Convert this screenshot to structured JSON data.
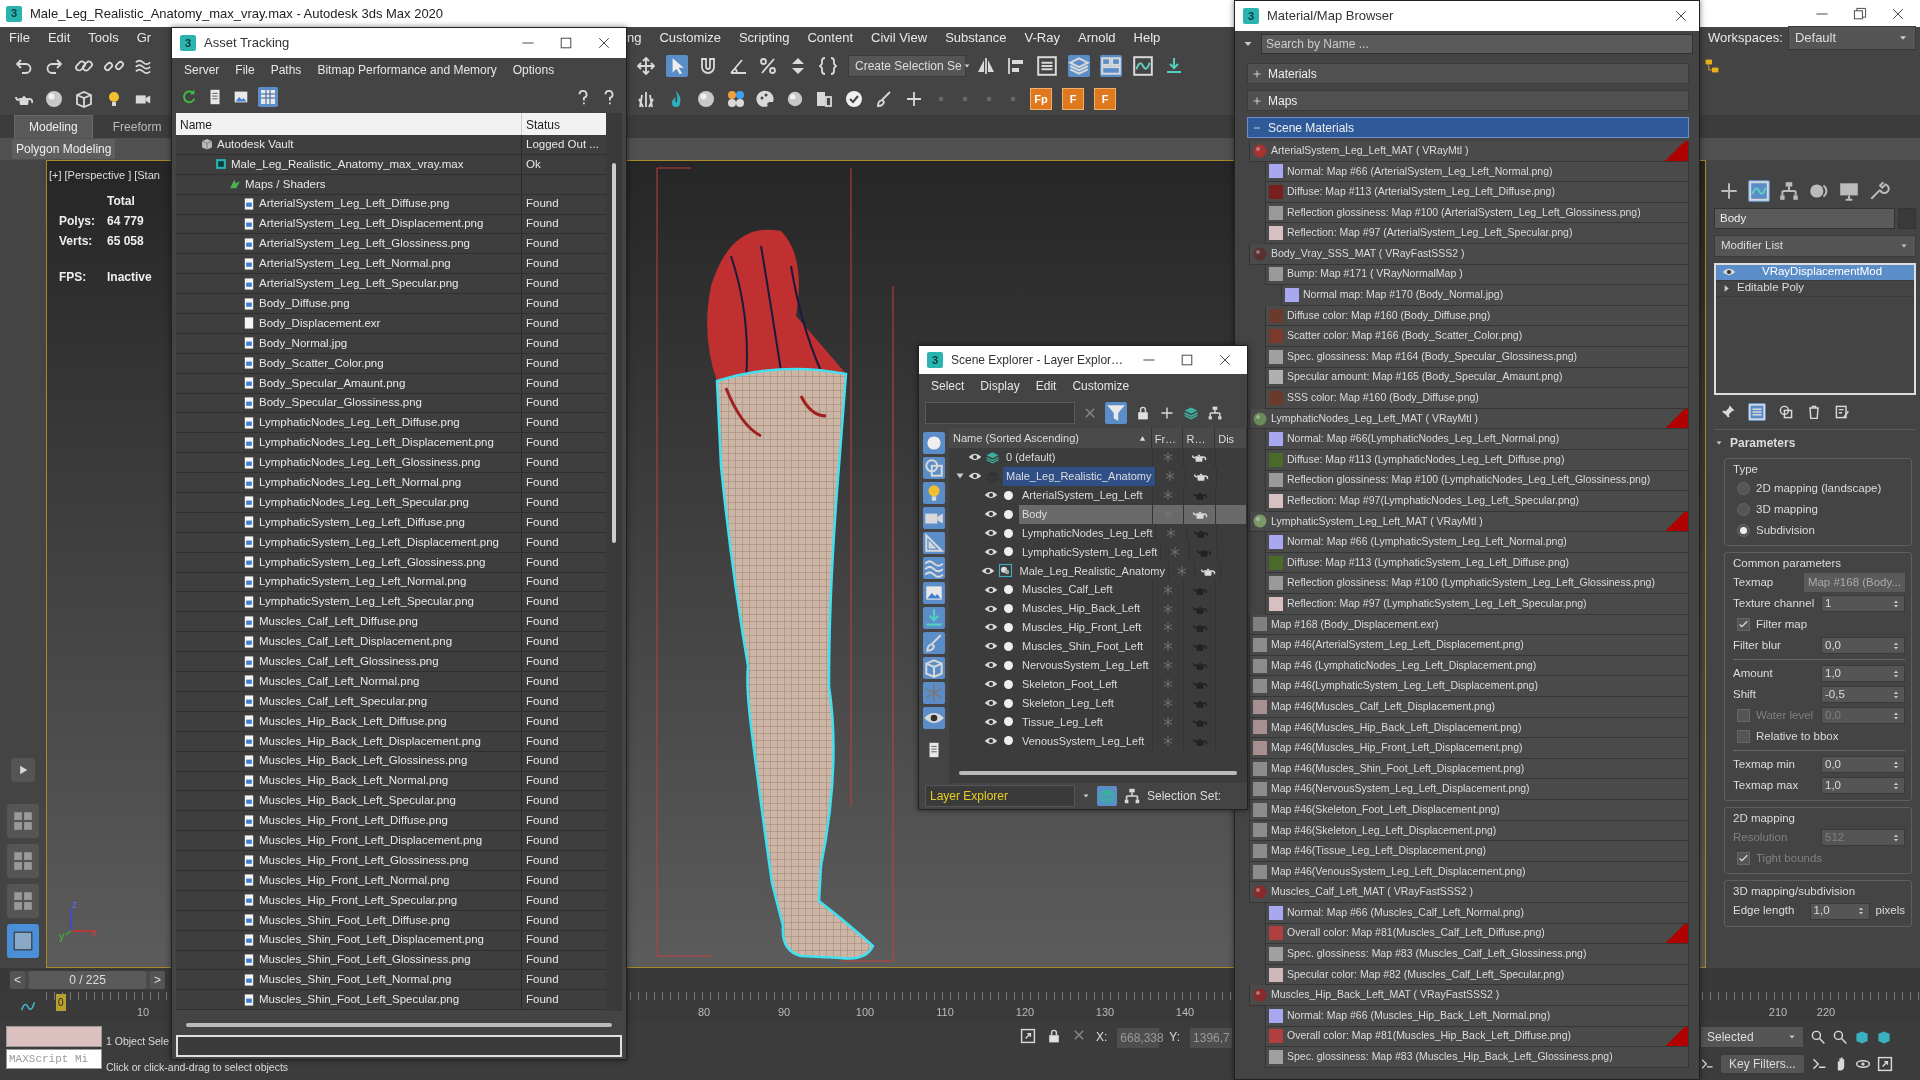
{
  "app_window": {
    "logo": "3",
    "title": "Male_Leg_Realistic_Anatomy_max_vray.max - Autodesk 3ds Max 2020"
  },
  "menu_bar": {
    "items_left": [
      "File",
      "Edit",
      "Tools",
      "Gr"
    ],
    "items_right": [
      "ng",
      "Customize",
      "Scripting",
      "Content",
      "Civil View",
      "Substance",
      "V-Ray",
      "Arnold",
      "Help"
    ],
    "workspaces_label": "Workspaces:",
    "workspaces_value": "Default"
  },
  "toolbar": {
    "selection_set": "Create Selection Se",
    "plugin_buttons": [
      "Fp",
      "F",
      "F"
    ]
  },
  "ribbon": {
    "tabs": [
      {
        "label": "Modeling",
        "selected": true
      },
      {
        "label": "Freeform",
        "selected": false
      }
    ],
    "panel": "Polygon Modeling"
  },
  "viewport": {
    "labels": [
      "[+]",
      "[Perspective ]",
      "[Stan"
    ],
    "stats_header": "Total",
    "stats": [
      {
        "label": "Polys:",
        "value": "64 779"
      },
      {
        "label": "Verts:",
        "value": "65 058"
      }
    ],
    "fps_label": "FPS:",
    "fps_value": "Inactive",
    "axis_labels": [
      "z",
      "y",
      "x"
    ],
    "layouts": [
      {
        "selected": false
      },
      {
        "selected": false
      },
      {
        "selected": false
      },
      {
        "selected": true
      }
    ]
  },
  "time_slider": {
    "position": "0 / 225",
    "level": 0,
    "prev": "<",
    "next": ">"
  },
  "timeline": {
    "current_frame": "0",
    "ticks": [
      "10",
      "80",
      "90",
      "100",
      "110",
      "120",
      "130",
      "140",
      "210",
      "220"
    ]
  },
  "status_bar": {
    "maxscript_placeholder": "MAXScript Mi",
    "selection": "1 Object Sele",
    "prompt": "Click or click-and-drag to select objects",
    "x_label": "X:",
    "x_value": "668,338",
    "y_label": "Y:",
    "y_value": "1396,7",
    "selection_filter": "Selected",
    "key_filters": "Key Filters..."
  },
  "command_panel": {
    "tabs": [
      {
        "selected": false
      },
      {
        "selected": true
      },
      {
        "selected": false
      },
      {
        "selected": false
      },
      {
        "selected": false
      },
      {
        "selected": false
      }
    ],
    "object_name": "Body",
    "modifier_list": "Modifier List",
    "stack": [
      {
        "kind": "modifier",
        "label": "VRayDisplacementMod",
        "selected": true
      },
      {
        "kind": "base",
        "label": "Editable Poly",
        "selected": false
      }
    ],
    "rollout": {
      "title": "Parameters",
      "groups": [
        {
          "title": "Type",
          "rows": [
            {
              "kind": "radio",
              "label": "2D mapping (landscape)",
              "selected": false,
              "disabled": false
            },
            {
              "kind": "radio",
              "label": "3D mapping",
              "selected": false,
              "disabled": false
            },
            {
              "kind": "radio",
              "label": "Subdivision",
              "selected": true,
              "disabled": false
            }
          ]
        },
        {
          "title": "Common parameters",
          "rows": [
            {
              "kind": "button",
              "label": "Texmap",
              "value": "Map #168 (Body...",
              "disabled": false
            },
            {
              "kind": "spinner",
              "label": "Texture channel",
              "value": "1",
              "disabled": false
            },
            {
              "kind": "checkbox",
              "label": "Filter map",
              "checked": true,
              "disabled": false
            },
            {
              "kind": "spinner",
              "label": "Filter blur",
              "value": "0,0",
              "disabled": false
            },
            {
              "kind": "spinner",
              "label": "Amount",
              "value": "1,0",
              "divider_before": true,
              "disabled": false
            },
            {
              "kind": "spinner",
              "label": "Shift",
              "value": "-0,5",
              "disabled": false
            },
            {
              "kind": "checkspinner",
              "label": "Water level",
              "value": "0,0",
              "checked": false,
              "disabled": true
            },
            {
              "kind": "checkbox",
              "label": "Relative to bbox",
              "checked": false,
              "disabled": false
            },
            {
              "kind": "spinner",
              "label": "Texmap min",
              "value": "0,0",
              "divider_before": true,
              "disabled": false
            },
            {
              "kind": "spinner",
              "label": "Texmap max",
              "value": "1,0",
              "disabled": false
            }
          ]
        },
        {
          "title": "2D mapping",
          "rows": [
            {
              "kind": "spinner",
              "label": "Resolution",
              "value": "512",
              "disabled": true
            },
            {
              "kind": "checkbox",
              "label": "Tight bounds",
              "checked": true,
              "disabled": true
            }
          ]
        },
        {
          "title": "3D mapping/subdivision",
          "rows": [
            {
              "kind": "spinner",
              "label": "Edge length",
              "value": "1,0",
              "unit": "pixels",
              "disabled": false
            }
          ]
        }
      ]
    }
  },
  "asset_tracking": {
    "logo": "3",
    "title": "Asset Tracking",
    "menu": [
      "Server",
      "File",
      "Paths",
      "Bitmap Performance and Memory",
      "Options"
    ],
    "columns": [
      "Name",
      "Status"
    ],
    "tree": [
      {
        "kind": "vault",
        "name": "Autodesk Vault",
        "status": "Logged Out ...",
        "children": [
          {
            "kind": "scene",
            "name": "Male_Leg_Realistic_Anatomy_max_vray.max",
            "status": "Ok",
            "children": [
              {
                "kind": "folder",
                "name": "Maps / Shaders",
                "children": [
                  {
                    "kind": "bitmap",
                    "name": "ArterialSystem_Leg_Left_Diffuse.png",
                    "status": "Found"
                  },
                  {
                    "kind": "bitmap",
                    "name": "ArterialSystem_Leg_Left_Displacement.png",
                    "status": "Found"
                  },
                  {
                    "kind": "bitmap",
                    "name": "ArterialSystem_Leg_Left_Glossiness.png",
                    "status": "Found"
                  },
                  {
                    "kind": "bitmap",
                    "name": "ArterialSystem_Leg_Left_Normal.png",
                    "status": "Found"
                  },
                  {
                    "kind": "bitmap",
                    "name": "ArterialSystem_Leg_Left_Specular.png",
                    "status": "Found"
                  },
                  {
                    "kind": "bitmap",
                    "name": "Body_Diffuse.png",
                    "status": "Found"
                  },
                  {
                    "kind": "plain",
                    "name": "Body_Displacement.exr",
                    "status": "Found"
                  },
                  {
                    "kind": "bitmap",
                    "name": "Body_Normal.jpg",
                    "status": "Found"
                  },
                  {
                    "kind": "bitmap",
                    "name": "Body_Scatter_Color.png",
                    "status": "Found"
                  },
                  {
                    "kind": "bitmap",
                    "name": "Body_Specular_Amaunt.png",
                    "status": "Found"
                  },
                  {
                    "kind": "bitmap",
                    "name": "Body_Specular_Glossiness.png",
                    "status": "Found"
                  },
                  {
                    "kind": "bitmap",
                    "name": "LymphaticNodes_Leg_Left_Diffuse.png",
                    "status": "Found"
                  },
                  {
                    "kind": "bitmap",
                    "name": "LymphaticNodes_Leg_Left_Displacement.png",
                    "status": "Found"
                  },
                  {
                    "kind": "bitmap",
                    "name": "LymphaticNodes_Leg_Left_Glossiness.png",
                    "status": "Found"
                  },
                  {
                    "kind": "bitmap",
                    "name": "LymphaticNodes_Leg_Left_Normal.png",
                    "status": "Found"
                  },
                  {
                    "kind": "bitmap",
                    "name": "LymphaticNodes_Leg_Left_Specular.png",
                    "status": "Found"
                  },
                  {
                    "kind": "bitmap",
                    "name": "LymphaticSystem_Leg_Left_Diffuse.png",
                    "status": "Found"
                  },
                  {
                    "kind": "bitmap",
                    "name": "LymphaticSystem_Leg_Left_Displacement.png",
                    "status": "Found"
                  },
                  {
                    "kind": "bitmap",
                    "name": "LymphaticSystem_Leg_Left_Glossiness.png",
                    "status": "Found"
                  },
                  {
                    "kind": "bitmap",
                    "name": "LymphaticSystem_Leg_Left_Normal.png",
                    "status": "Found"
                  },
                  {
                    "kind": "bitmap",
                    "name": "LymphaticSystem_Leg_Left_Specular.png",
                    "status": "Found"
                  },
                  {
                    "kind": "bitmap",
                    "name": "Muscles_Calf_Left_Diffuse.png",
                    "status": "Found"
                  },
                  {
                    "kind": "bitmap",
                    "name": "Muscles_Calf_Left_Displacement.png",
                    "status": "Found"
                  },
                  {
                    "kind": "bitmap",
                    "name": "Muscles_Calf_Left_Glossiness.png",
                    "status": "Found"
                  },
                  {
                    "kind": "bitmap",
                    "name": "Muscles_Calf_Left_Normal.png",
                    "status": "Found"
                  },
                  {
                    "kind": "bitmap",
                    "name": "Muscles_Calf_Left_Specular.png",
                    "status": "Found"
                  },
                  {
                    "kind": "bitmap",
                    "name": "Muscles_Hip_Back_Left_Diffuse.png",
                    "status": "Found"
                  },
                  {
                    "kind": "bitmap",
                    "name": "Muscles_Hip_Back_Left_Displacement.png",
                    "status": "Found"
                  },
                  {
                    "kind": "bitmap",
                    "name": "Muscles_Hip_Back_Left_Glossiness.png",
                    "status": "Found"
                  },
                  {
                    "kind": "bitmap",
                    "name": "Muscles_Hip_Back_Left_Normal.png",
                    "status": "Found"
                  },
                  {
                    "kind": "bitmap",
                    "name": "Muscles_Hip_Back_Left_Specular.png",
                    "status": "Found"
                  },
                  {
                    "kind": "bitmap",
                    "name": "Muscles_Hip_Front_Left_Diffuse.png",
                    "status": "Found"
                  },
                  {
                    "kind": "bitmap",
                    "name": "Muscles_Hip_Front_Left_Displacement.png",
                    "status": "Found"
                  },
                  {
                    "kind": "bitmap",
                    "name": "Muscles_Hip_Front_Left_Glossiness.png",
                    "status": "Found"
                  },
                  {
                    "kind": "bitmap",
                    "name": "Muscles_Hip_Front_Left_Normal.png",
                    "status": "Found"
                  },
                  {
                    "kind": "bitmap",
                    "name": "Muscles_Hip_Front_Left_Specular.png",
                    "status": "Found"
                  },
                  {
                    "kind": "bitmap",
                    "name": "Muscles_Shin_Foot_Left_Diffuse.png",
                    "status": "Found"
                  },
                  {
                    "kind": "bitmap",
                    "name": "Muscles_Shin_Foot_Left_Displacement.png",
                    "status": "Found"
                  },
                  {
                    "kind": "bitmap",
                    "name": "Muscles_Shin_Foot_Left_Glossiness.png",
                    "status": "Found"
                  },
                  {
                    "kind": "bitmap",
                    "name": "Muscles_Shin_Foot_Left_Normal.png",
                    "status": "Found"
                  },
                  {
                    "kind": "bitmap",
                    "name": "Muscles_Shin_Foot_Left_Specular.png",
                    "status": "Found"
                  }
                ]
              }
            ]
          }
        ]
      }
    ]
  },
  "scene_explorer": {
    "logo": "3",
    "title": "Scene Explorer - Layer Explor…",
    "menu": [
      "Select",
      "Display",
      "Edit",
      "Customize"
    ],
    "columns": [
      "Name (Sorted Ascending)",
      "Fr…",
      "R…",
      "Dis"
    ],
    "tree": [
      {
        "kind": "layer",
        "name": "0 (default)",
        "selected": false,
        "renderable": true
      },
      {
        "kind": "layer",
        "name": "Male_Leg_Realistic_Anatomy",
        "selected": true,
        "renderable": true,
        "expanded": true,
        "children": [
          {
            "kind": "object",
            "name": "ArterialSystem_Leg_Left",
            "selected": false,
            "renderable": false
          },
          {
            "kind": "object",
            "name": "Body",
            "selected": true,
            "renderable": true
          },
          {
            "kind": "object",
            "name": "LymphaticNodes_Leg_Left",
            "selected": false,
            "renderable": false
          },
          {
            "kind": "object",
            "name": "LymphaticSystem_Leg_Left",
            "selected": false,
            "renderable": false
          },
          {
            "kind": "container",
            "name": "Male_Leg_Realistic_Anatomy",
            "selected": false,
            "renderable": true
          },
          {
            "kind": "object",
            "name": "Muscles_Calf_Left",
            "selected": false,
            "renderable": false
          },
          {
            "kind": "object",
            "name": "Muscles_Hip_Back_Left",
            "selected": false,
            "renderable": false
          },
          {
            "kind": "object",
            "name": "Muscles_Hip_Front_Left",
            "selected": false,
            "renderable": false
          },
          {
            "kind": "object",
            "name": "Muscles_Shin_Foot_Left",
            "selected": false,
            "renderable": false
          },
          {
            "kind": "object",
            "name": "NervousSystem_Leg_Left",
            "selected": false,
            "renderable": false
          },
          {
            "kind": "object",
            "name": "Skeleton_Foot_Left",
            "selected": false,
            "renderable": false
          },
          {
            "kind": "object",
            "name": "Skeleton_Leg_Left",
            "selected": false,
            "renderable": false
          },
          {
            "kind": "object",
            "name": "Tissue_Leg_Left",
            "selected": false,
            "renderable": false
          },
          {
            "kind": "object",
            "name": "VenousSystem_Leg_Left",
            "selected": false,
            "renderable": false
          }
        ]
      }
    ],
    "explorer_type": "Layer Explorer",
    "selection_set_label": "Selection Set:"
  },
  "material_browser": {
    "logo": "3",
    "title": "Material/Map Browser",
    "search_placeholder": "Search by Name ...",
    "groups": [
      {
        "label": "Materials",
        "expanded": false,
        "selected": false
      },
      {
        "label": "Maps",
        "expanded": false,
        "selected": false
      },
      {
        "label": "Scene Materials",
        "expanded": true,
        "selected": true
      }
    ],
    "items": [
      {
        "kind": "material",
        "name": "ArterialSystem_Leg_Left_MAT ( VRayMtl )",
        "color": "#a83232",
        "marked": true,
        "children": [
          {
            "kind": "map",
            "name": "Normal: Map #66 (ArterialSystem_Leg_Left_Normal.png)",
            "color": "#a8a8f0",
            "marked": false
          },
          {
            "kind": "map",
            "name": "Diffuse: Map #113 (ArterialSystem_Leg_Left_Diffuse.png)",
            "color": "#7a1f1f",
            "marked": false
          },
          {
            "kind": "map",
            "name": "Reflection glossiness: Map #100 (ArterialSystem_Leg_Left_Glossiness.png)",
            "color": "#9a9a9a",
            "marked": false
          },
          {
            "kind": "map",
            "name": "Reflection: Map #97 (ArterialSystem_Leg_Left_Specular.png)",
            "color": "#d8c0c0",
            "marked": false
          }
        ]
      },
      {
        "kind": "material",
        "name": "Body_Vray_SSS_MAT ( VRayFastSSS2 )",
        "color": "#5a3030",
        "marked": false,
        "children": [
          {
            "kind": "map",
            "name": "Bump: Map #171 ( VRayNormalMap )",
            "color": "#9a9a9a",
            "marked": false,
            "children": [
              {
                "kind": "map",
                "name": "Normal map: Map #170 (Body_Normal.jpg)",
                "color": "#a8a8f0",
                "marked": false
              }
            ]
          },
          {
            "kind": "map",
            "name": "Diffuse color: Map #160 (Body_Diffuse.png)",
            "color": "#6a3a2a",
            "marked": false
          },
          {
            "kind": "map",
            "name": "Scatter color: Map #166 (Body_Scatter_Color.png)",
            "color": "#7a3a2a",
            "marked": false
          },
          {
            "kind": "map",
            "name": "Spec. glossiness: Map #164 (Body_Specular_Glossiness.png)",
            "color": "#a0a0a0",
            "marked": false
          },
          {
            "kind": "map",
            "name": "Specular amount: Map #165 (Body_Specular_Amaunt.png)",
            "color": "#b0b0b0",
            "marked": false
          },
          {
            "kind": "map",
            "name": "SSS color: Map #160 (Body_Diffuse.png)",
            "color": "#6a3a2a",
            "marked": false
          }
        ]
      },
      {
        "kind": "material",
        "name": "LymphaticNodes_Leg_Left_MAT ( VRayMtl )",
        "color": "#6a8a5a",
        "marked": true,
        "children": [
          {
            "kind": "map",
            "name": "Normal: Map #66(LymphaticNodes_Leg_Left_Normal.png)",
            "color": "#a8a8f0",
            "marked": false
          },
          {
            "kind": "map",
            "name": "Diffuse: Map #113 (LymphaticNodes_Leg_Left_Diffuse.png)",
            "color": "#4a6a2a",
            "marked": false
          },
          {
            "kind": "map",
            "name": "Reflection glossiness: Map #100 (LymphaticNodes_Leg_Left_Glossiness.png)",
            "color": "#9a9a9a",
            "marked": false
          },
          {
            "kind": "map",
            "name": "Reflection: Map #97(LymphaticNodes_Leg_Left_Specular.png)",
            "color": "#d8c0c0",
            "marked": false
          }
        ]
      },
      {
        "kind": "material",
        "name": "LymphaticSystem_Leg_Left_MAT ( VRayMtl )",
        "color": "#7a9a6a",
        "marked": true,
        "children": [
          {
            "kind": "map",
            "name": "Normal: Map #66 (LymphaticSystem_Leg_Left_Normal.png)",
            "color": "#a8a8f0",
            "marked": false
          },
          {
            "kind": "map",
            "name": "Diffuse: Map #113 (LymphaticSystem_Leg_Left_Diffuse.png)",
            "color": "#4a6a2a",
            "marked": false
          },
          {
            "kind": "map",
            "name": "Reflection glossiness: Map #100 (LymphaticSystem_Leg_Left_Glossiness.png)",
            "color": "#9a9a9a",
            "marked": false
          },
          {
            "kind": "map",
            "name": "Reflection: Map #97 (LymphaticSystem_Leg_Left_Specular.png)",
            "color": "#d8c0c0",
            "marked": false
          }
        ]
      },
      {
        "kind": "map",
        "name": "Map #168 (Body_Displacement.exr)",
        "color": "#808080",
        "marked": false
      },
      {
        "kind": "map",
        "name": "Map #46(ArterialSystem_Leg_Left_Displacement.png)",
        "color": "#8c8c8c",
        "marked": false
      },
      {
        "kind": "map",
        "name": "Map #46 (LymphaticNodes_Leg_Left_Displacement.png)",
        "color": "#8c8c8c",
        "marked": false
      },
      {
        "kind": "map",
        "name": "Map #46(LymphaticSystem_Leg_Left_Displacement.png)",
        "color": "#8c8c8c",
        "marked": false
      },
      {
        "kind": "map",
        "name": "Map #46(Muscles_Calf_Left_Displacement.png)",
        "color": "#a89090",
        "marked": false
      },
      {
        "kind": "map",
        "name": "Map #46(Muscles_Hip_Back_Left_Displacement.png)",
        "color": "#a89090",
        "marked": false
      },
      {
        "kind": "map",
        "name": "Map #46(Muscles_Hip_Front_Left_Displacement.png)",
        "color": "#a89090",
        "marked": false
      },
      {
        "kind": "map",
        "name": "Map #46(Muscles_Shin_Foot_Left_Displacement.png)",
        "color": "#8c8c8c",
        "marked": false
      },
      {
        "kind": "map",
        "name": "Map #46(NervousSystem_Leg_Left_Displacement.png)",
        "color": "#8c8c8c",
        "marked": false
      },
      {
        "kind": "map",
        "name": "Map #46(Skeleton_Foot_Left_Displacement.png)",
        "color": "#8c8c8c",
        "marked": false
      },
      {
        "kind": "map",
        "name": "Map #46(Skeleton_Leg_Left_Displacement.png)",
        "color": "#8c8c8c",
        "marked": false
      },
      {
        "kind": "map",
        "name": "Map #46(Tissue_Leg_Left_Displacement.png)",
        "color": "#8c8c8c",
        "marked": false
      },
      {
        "kind": "map",
        "name": "Map #46(VenousSystem_Leg_Left_Displacement.png)",
        "color": "#8c8c8c",
        "marked": false
      },
      {
        "kind": "material",
        "name": "Muscles_Calf_Left_MAT ( VRayFastSSS2 )",
        "color": "#8a2a2a",
        "marked": false,
        "children": [
          {
            "kind": "map",
            "name": "Normal: Map #66 (Muscles_Calf_Left_Normal.png)",
            "color": "#a8a8f0",
            "marked": false
          },
          {
            "kind": "map",
            "name": "Overall color: Map #81(Muscles_Calf_Left_Diffuse.png)",
            "color": "#b04040",
            "marked": true
          },
          {
            "kind": "map",
            "name": "Spec. glossiness: Map #83 (Muscles_Calf_Left_Glossiness.png)",
            "color": "#a0a0a0",
            "marked": false
          },
          {
            "kind": "map",
            "name": "Specular color: Map #82 (Muscles_Calf_Left_Specular.png)",
            "color": "#d0b8b8",
            "marked": false
          }
        ]
      },
      {
        "kind": "material",
        "name": "Muscles_Hip_Back_Left_MAT ( VRayFastSSS2 )",
        "color": "#8a2a2a",
        "marked": false,
        "children": [
          {
            "kind": "map",
            "name": "Normal: Map #66 (Muscles_Hip_Back_Left_Normal.png)",
            "color": "#a8a8f0",
            "marked": false
          },
          {
            "kind": "map",
            "name": "Overall color: Map #81(Muscles_Hip_Back_Left_Diffuse.png)",
            "color": "#b04040",
            "marked": true
          },
          {
            "kind": "map",
            "name": "Spec. glossiness: Map #83 (Muscles_Hip_Back_Left_Glossiness.png)",
            "color": "#a0a0a0",
            "marked": false
          }
        ]
      }
    ]
  }
}
